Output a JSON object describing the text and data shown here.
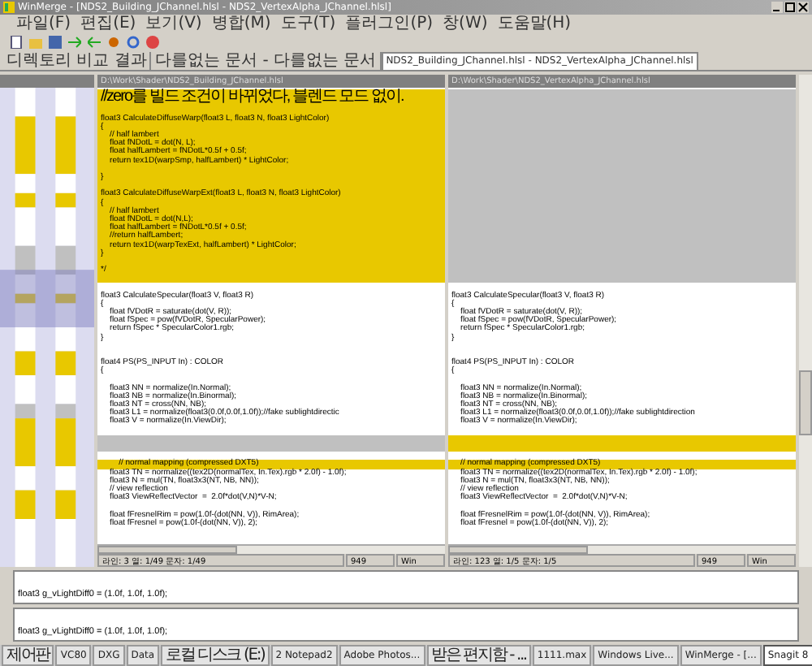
{
  "window": {
    "title": "WinMerge - [NDS2_Building_JChannel.hlsl - NDS2_VertexAlpha_JChannel.hlsl]"
  },
  "menu": [
    "파일(F)",
    "편집(E)",
    "보기(V)",
    "병합(M)",
    "도구(T)",
    "플러그인(P)",
    "창(W)",
    "도움말(H)"
  ],
  "tabs": [
    {
      "label": "디렉토리 비교 결과",
      "selected": false
    },
    {
      "label": "다를없는 문서 - 다를없는 문서",
      "selected": false
    },
    {
      "label": "NDS2_Building_JChannel.hlsl - NDS2_VertexAlpha_JChannel.hlsl",
      "selected": true
    }
  ],
  "panes": [
    {
      "path": "D:\\Work\\Shader\\NDS2_Building_JChannel.hlsl",
      "lines": [
        {
          "kind": "changed",
          "text": "//zero를 빌드 조건이 바뀌었다, 블렌드 모드 없이."
        },
        {
          "kind": "changed"
        },
        {
          "kind": "changed",
          "text": "float3 CalculateDiffuseWarp(float3 L, float3 N, float3 LightColor)"
        },
        {
          "kind": "changed",
          "text": "{"
        },
        {
          "kind": "changed",
          "text": "    // half lambert"
        },
        {
          "kind": "changed",
          "text": "    float fNDotL = dot(N, L);"
        },
        {
          "kind": "changed",
          "text": "    float halfLambert = fNDotL*0.5f + 0.5f;"
        },
        {
          "kind": "changed",
          "text": "    return tex1D(warpSmp, halfLambert) * LightColor;"
        },
        {
          "kind": "changed"
        },
        {
          "kind": "changed",
          "text": "}"
        },
        {
          "kind": "changed"
        },
        {
          "kind": "changed",
          "text": "float3 CalculateDiffuseWarpExt(float3 L, float3 N, float3 LightColor)"
        },
        {
          "kind": "changed",
          "text": "{"
        },
        {
          "kind": "changed",
          "text": "    // half lambert"
        },
        {
          "kind": "changed",
          "text": "    float fNDotL = dot(N,L);"
        },
        {
          "kind": "changed",
          "text": "    float halfLambert = fNDotL*0.5f + 0.5f;"
        },
        {
          "kind": "changed",
          "text": "    //return halfLambert;"
        },
        {
          "kind": "changed",
          "text": "    return tex1D(warpTexExt, halfLambert) * LightColor;"
        },
        {
          "kind": "changed",
          "text": "}"
        },
        {
          "kind": "changed"
        },
        {
          "kind": "changed",
          "text": "*/"
        },
        {
          "kind": "changed"
        },
        {
          "kind": "same"
        },
        {
          "kind": "same",
          "text": "float3 CalculateSpecular(float3 V, float3 R)"
        },
        {
          "kind": "same",
          "text": "{"
        },
        {
          "kind": "same",
          "text": "    float fVDotR = saturate(dot(V, R));"
        },
        {
          "kind": "same",
          "text": "    float fSpec = pow(fVDotR, SpecularPower);"
        },
        {
          "kind": "same",
          "text": "    return fSpec * SpecularColor1.rgb;"
        },
        {
          "kind": "same",
          "text": "}"
        },
        {
          "kind": "same"
        },
        {
          "kind": "same"
        },
        {
          "kind": "same",
          "text": "float4 PS(PS_INPUT In) : COLOR"
        },
        {
          "kind": "same",
          "text": "{"
        },
        {
          "kind": "same"
        },
        {
          "kind": "same",
          "text": "    float3 NN = normalize(In.Normal);"
        },
        {
          "kind": "same",
          "text": "    float3 NB = normalize(In.Binormal);"
        },
        {
          "kind": "same",
          "text": "    float3 NT = cross(NN, NB);"
        },
        {
          "kind": "same",
          "text": "    float3 L1 = normalize(float3(0.0f,0.0f,1.0f));//fake sublightdirectic"
        },
        {
          "kind": "same",
          "text": "    float3 V = normalize(In.ViewDir);"
        },
        {
          "kind": "same"
        },
        {
          "kind": "missing"
        },
        {
          "kind": "missing"
        },
        {
          "kind": "same"
        },
        {
          "kind": "changed",
          "text": "        // normal mapping (compressed DXT5)"
        },
        {
          "kind": "same",
          "text": "    float3 TN = normalize((tex2D(normalTex, In.Tex).rgb * 2.0f) - 1.0f);"
        },
        {
          "kind": "same",
          "text": "    float3 N = mul(TN, float3x3(NT, NB, NN));"
        },
        {
          "kind": "same",
          "text": "    // view reflection"
        },
        {
          "kind": "same",
          "text": "    float3 ViewReflectVector  =  2.0f*dot(V,N)*V-N;"
        },
        {
          "kind": "same"
        },
        {
          "kind": "same",
          "text": "    float fFresnelRim = pow(1.0f-(dot(NN, V)), RimArea);"
        },
        {
          "kind": "same",
          "text": "    float fFresnel = pow(1.0f-(dot(NN, V)), 2);"
        }
      ],
      "status": [
        "라인: 3 열: 1/49 문자: 1/49",
        "949",
        "Win"
      ]
    },
    {
      "path": "D:\\Work\\Shader\\NDS2_VertexAlpha_JChannel.hlsl",
      "lines": [
        {
          "kind": "missing"
        },
        {
          "kind": "missing"
        },
        {
          "kind": "missing"
        },
        {
          "kind": "missing"
        },
        {
          "kind": "missing"
        },
        {
          "kind": "missing"
        },
        {
          "kind": "missing"
        },
        {
          "kind": "missing"
        },
        {
          "kind": "missing"
        },
        {
          "kind": "missing"
        },
        {
          "kind": "missing"
        },
        {
          "kind": "missing"
        },
        {
          "kind": "missing"
        },
        {
          "kind": "missing"
        },
        {
          "kind": "missing"
        },
        {
          "kind": "missing"
        },
        {
          "kind": "missing"
        },
        {
          "kind": "missing"
        },
        {
          "kind": "missing"
        },
        {
          "kind": "missing"
        },
        {
          "kind": "missing"
        },
        {
          "kind": "missing"
        },
        {
          "kind": "same"
        },
        {
          "kind": "same",
          "text": "float3 CalculateSpecular(float3 V, float3 R)"
        },
        {
          "kind": "same",
          "text": "{"
        },
        {
          "kind": "same",
          "text": "    float fVDotR = saturate(dot(V, R));"
        },
        {
          "kind": "same",
          "text": "    float fSpec = pow(fVDotR, SpecularPower);"
        },
        {
          "kind": "same",
          "text": "    return fSpec * SpecularColor1.rgb;"
        },
        {
          "kind": "same",
          "text": "}"
        },
        {
          "kind": "same"
        },
        {
          "kind": "same"
        },
        {
          "kind": "same",
          "text": "float4 PS(PS_INPUT In) : COLOR"
        },
        {
          "kind": "same",
          "text": "{"
        },
        {
          "kind": "same"
        },
        {
          "kind": "same",
          "text": "    float3 NN = normalize(In.Normal);"
        },
        {
          "kind": "same",
          "text": "    float3 NB = normalize(In.Binormal);"
        },
        {
          "kind": "same",
          "text": "    float3 NT = cross(NN, NB);"
        },
        {
          "kind": "same",
          "text": "    float3 L1 = normalize(float3(0.0f,0.0f,1.0f));//fake sublightdirection"
        },
        {
          "kind": "same",
          "text": "    float3 V = normalize(In.ViewDir);"
        },
        {
          "kind": "same"
        },
        {
          "kind": "changed"
        },
        {
          "kind": "changed"
        },
        {
          "kind": "same"
        },
        {
          "kind": "changed",
          "text": "    // normal mapping (compressed DXT5)"
        },
        {
          "kind": "same",
          "text": "    float3 TN = normalize((tex2D(normalTex, In.Tex).rgb * 2.0f) - 1.0f);"
        },
        {
          "kind": "same",
          "text": "    float3 N = mul(TN, float3x3(NT, NB, NN));"
        },
        {
          "kind": "same",
          "text": "    // view reflection"
        },
        {
          "kind": "same",
          "text": "    float3 ViewReflectVector  =  2.0f*dot(V,N)*V-N;"
        },
        {
          "kind": "same"
        },
        {
          "kind": "same",
          "text": "    float fFresnelRim = pow(1.0f-(dot(NN, V)), RimArea);"
        },
        {
          "kind": "same",
          "text": "    float fFresnel = pow(1.0f-(dot(NN, V)), 2);"
        }
      ],
      "status": [
        "라인: 123 열: 1/5 문자: 1/5",
        "949",
        "Win"
      ]
    }
  ],
  "detail": [
    "float3 g_vLightDiff0 = (1.0f, 1.0f, 1.0f);",
    "float3 g_vLightDiff0 = (1.0f, 1.0f, 1.0f);"
  ],
  "taskbar": [
    {
      "label": "제어판",
      "selected": false
    },
    {
      "label": "VC80",
      "selected": false
    },
    {
      "label": "DXG",
      "selected": false
    },
    {
      "label": "Data",
      "selected": false
    },
    {
      "label": "로컬 디스크 (E:)",
      "selected": false
    },
    {
      "label": "2 Notepad2",
      "selected": false
    },
    {
      "label": "Adobe Photos...",
      "selected": false
    },
    {
      "label": "받은 편지함 - ...",
      "selected": false
    },
    {
      "label": "1111.max",
      "selected": false
    },
    {
      "label": "Windows Live...",
      "selected": false
    },
    {
      "label": "WinMerge - [...",
      "selected": false
    },
    {
      "label": "Snagit 8",
      "selected": true
    }
  ]
}
